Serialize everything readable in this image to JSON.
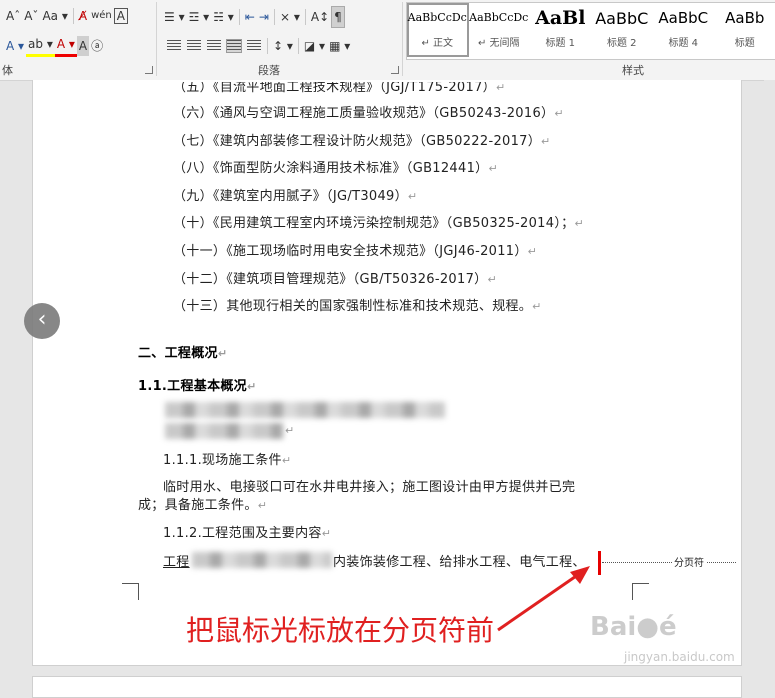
{
  "ribbon": {
    "font_row1": [
      "Aˆ",
      "Aˇ",
      "Aa ▾",
      "A̸",
      "wén",
      "A"
    ],
    "font_row2": [
      "A ▾",
      "ab ▾",
      "A ▾",
      "A",
      "ⓐ"
    ],
    "paragraph_row1": [
      "☰ ▾",
      "☲ ▾",
      "☵ ▾",
      "⇤",
      "⇥",
      "⨯ ▾",
      "A↕",
      "¶"
    ],
    "paragraph_row2": [
      "↕ ▾",
      "◪ ▾",
      "▦ ▾"
    ],
    "font_group_label": "体",
    "paragraph_group_label": "段落",
    "styles_group_label": "样式",
    "styles": [
      {
        "sample": "AaBbCcDc",
        "name": "↵ 正文"
      },
      {
        "sample": "AaBbCcDc",
        "name": "↵ 无间隔"
      },
      {
        "sample": "AaBl",
        "name": "标题 1"
      },
      {
        "sample": "AaBbC",
        "name": "标题 2"
      },
      {
        "sample": "AaBbC",
        "name": "标题 4"
      },
      {
        "sample": "AaBb",
        "name": "标题"
      }
    ]
  },
  "document": {
    "lines": [
      "（五）《自流平地面工程技术规程》（JGJ/T175-2017）",
      "（六）《通风与空调工程施工质量验收规范》（GB50243-2016）",
      "（七）《建筑内部装修工程设计防火规范》（GB50222-2017）",
      "（八）《饰面型防火涂料通用技术标准》（GB12441）",
      "（九）《建筑室内用腻子》（JG/T3049）",
      "（十）《民用建筑工程室内环境污染控制规范》（GB50325-2014）；",
      "（十一）《施工现场临时用电安全技术规范》（JGJ46-2011）",
      "（十二）《建筑项目管理规范》（GB/T50326-2017）",
      "（十三）其他现行相关的国家强制性标准和技术规范、规程。"
    ],
    "heading2": "二、工程概况",
    "heading3": "1.1.工程基本概况",
    "sub1": "1.1.1.现场施工条件",
    "body1": "临时用水、电接驳口可在水井电井接入；施工图设计由甲方提供并已完",
    "body1_cont": "成；具备施工条件。",
    "sub2": "1.1.2.工程范围及主要内容",
    "body2_start": "工程",
    "body2_end": "内装饰装修工程、给排水工程、电气工程、",
    "page_break_label": "分页符",
    "para_mark": "↵"
  },
  "annotation": {
    "text": "把鼠标光标放在分页符前",
    "color": "#e02020"
  },
  "watermark": {
    "text": "Bai●é ",
    "sub": "jingyan.baidu.com"
  },
  "nav": {
    "prev_symbol": "‹"
  }
}
